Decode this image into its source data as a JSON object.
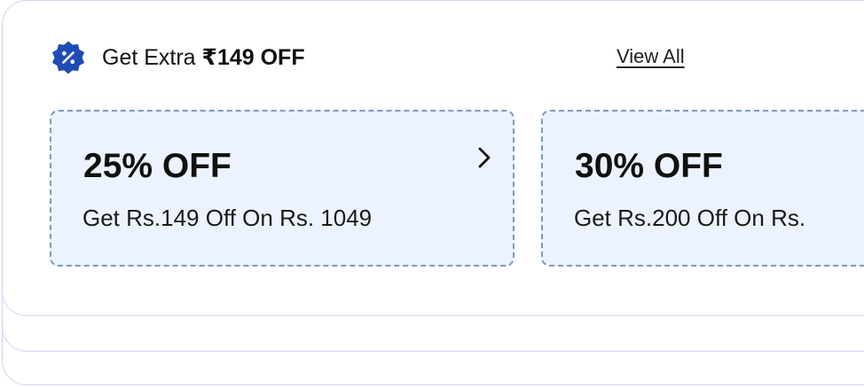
{
  "offers_section": {
    "title_prefix": "Get Extra ",
    "title_amount": "₹149 OFF",
    "view_all_label": "View All",
    "badge_icon": "discount-badge-icon",
    "colors": {
      "badge": "#1f4bb4",
      "coupon_background": "#ecf3ff",
      "coupon_border": "#7f9abb",
      "card_border": "#d4d3f3"
    }
  },
  "coupons": [
    {
      "title": "25% OFF",
      "description": "Get Rs.149 Off On Rs. 1049",
      "icon": "chevron-right-icon"
    },
    {
      "title": "30% OFF",
      "description": "Get Rs.200 Off On Rs."
    }
  ]
}
